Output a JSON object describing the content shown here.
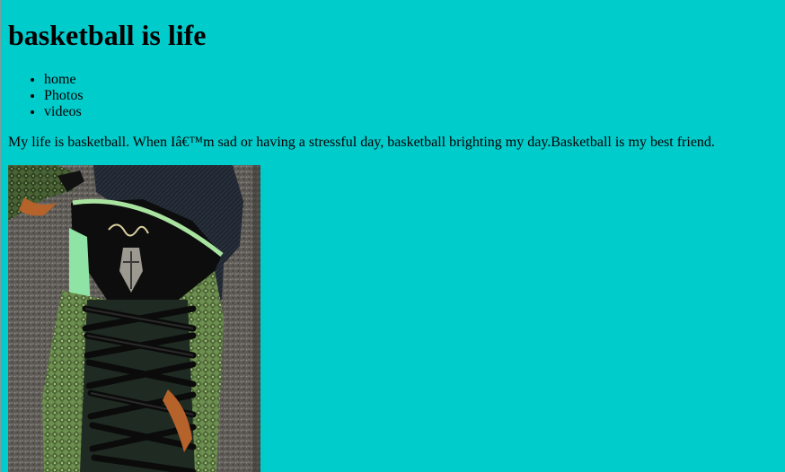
{
  "page": {
    "title": "basketball is life",
    "background_color": "#00cccc"
  },
  "nav": {
    "items": [
      {
        "label": "home"
      },
      {
        "label": "Photos"
      },
      {
        "label": "videos"
      }
    ]
  },
  "intro": {
    "text": "My life is basketball. When Iâ€™m sad or having a stressful day, basketball brighting my day.Basketball is my best friend."
  },
  "photo": {
    "subject": "high-top basketball sneaker photo",
    "icon": "sneaker-photo"
  }
}
